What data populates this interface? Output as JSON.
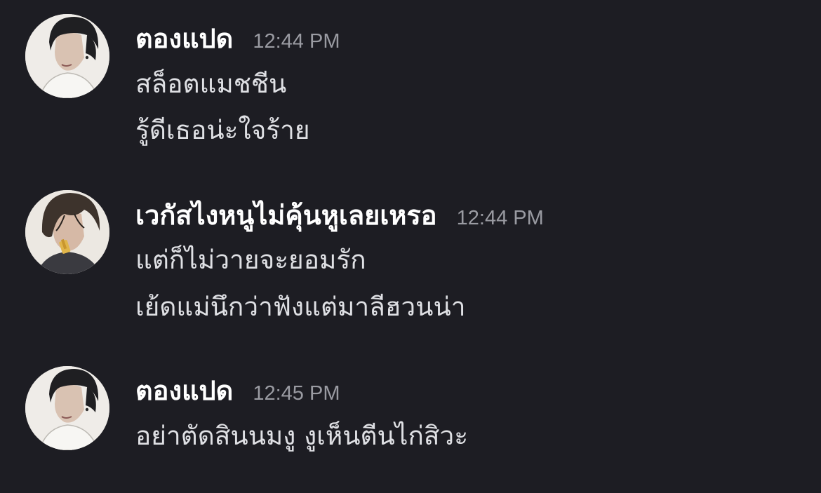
{
  "messages": [
    {
      "author": "ตองแปด",
      "time": "12:44 PM",
      "avatar_icon": "user-avatar-icon",
      "lines": [
        "สล็อตแมชชีน",
        "รู้ดีเธอน่ะใจร้าย"
      ]
    },
    {
      "author": "เวกัสไงหนูไม่คุ้นหูเลยเหรอ",
      "time": "12:44 PM",
      "avatar_icon": "user-avatar-icon",
      "lines": [
        "แต่ก็ไม่วายจะยอมรัก",
        "เย้ดแม่นึกว่าฟังแต่มาลีฮวนน่า"
      ]
    },
    {
      "author": "ตองแปด",
      "time": "12:45 PM",
      "avatar_icon": "user-avatar-icon",
      "lines": [
        "อย่าตัดสินนมงู งูเห็นตีนไก่สิวะ"
      ]
    }
  ],
  "colors": {
    "background": "#1d1d23",
    "author": "#ffffff",
    "timestamp": "#9a9ba2",
    "text": "#dfe0e4"
  }
}
